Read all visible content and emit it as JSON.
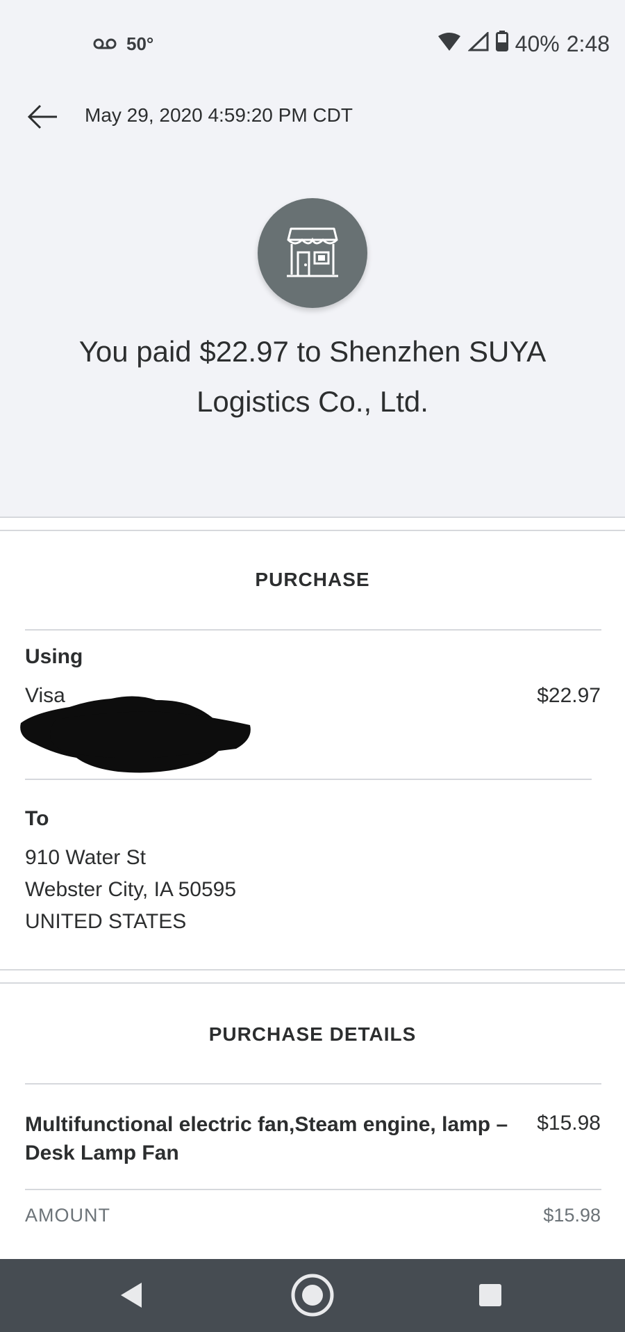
{
  "status_bar": {
    "temperature": "50°",
    "battery": "40%",
    "time": "2:48",
    "icons": [
      "voicemail-icon",
      "wifi-icon",
      "cell-signal-icon",
      "battery-icon"
    ]
  },
  "header": {
    "datetime": "May 29, 2020 4:59:20 PM CDT"
  },
  "summary": {
    "merchant_icon": "storefront-icon",
    "headline": "You paid $22.97 to Shenzhen SUYA Logistics Co., Ltd."
  },
  "purchase": {
    "title": "PURCHASE",
    "using_label": "Using",
    "method": "Visa",
    "amount": "$22.97",
    "to_label": "To",
    "address": [
      "910 Water St",
      "Webster City, IA 50595",
      "UNITED STATES"
    ]
  },
  "details": {
    "title": "PURCHASE DETAILS",
    "item_name": "Multifunctional electric fan,Steam engine, lamp – Desk Lamp Fan",
    "item_price": "$15.98",
    "amount_label": "AMOUNT",
    "amount_value": "$15.98"
  },
  "nav": {
    "icons": [
      "back-triangle-icon",
      "home-circle-icon",
      "recents-square-icon"
    ]
  },
  "colors": {
    "top_background": "#f2f3f7",
    "merchant_circle": "#687173",
    "nav_background": "#464c52",
    "divider": "#d6d8dc"
  }
}
